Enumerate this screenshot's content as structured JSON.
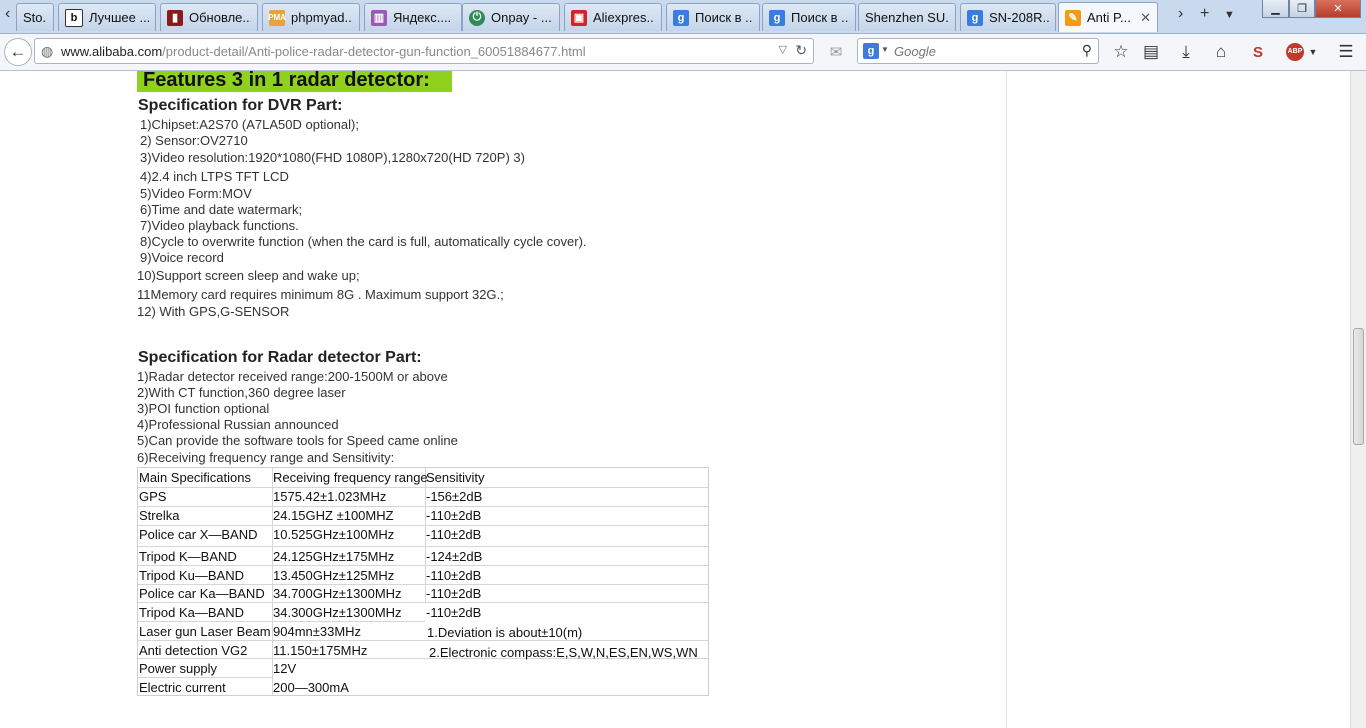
{
  "tabs": [
    {
      "title": "Sto...",
      "icon": "page-icon"
    },
    {
      "title": "Лучшее ...",
      "icon": "b-icon"
    },
    {
      "title": "Обновле...",
      "icon": "phone-icon"
    },
    {
      "title": "phpmyad...",
      "icon": "pma-icon"
    },
    {
      "title": "Яндекс....",
      "icon": "chart-icon"
    },
    {
      "title": "Onpay - ...",
      "icon": "power-icon"
    },
    {
      "title": "Aliexpres...",
      "icon": "bag-icon"
    },
    {
      "title": "Поиск в ...",
      "icon": "google-icon"
    },
    {
      "title": "Поиск в ...",
      "icon": "google-icon"
    },
    {
      "title": "Shenzhen SU...",
      "icon": ""
    },
    {
      "title": "SN-208R...",
      "icon": "google-icon"
    },
    {
      "title": "Anti P...",
      "icon": "alibaba-icon",
      "active": true
    }
  ],
  "nav": {
    "url_host": "www.alibaba.com",
    "url_path": "/product-detail/Anti-police-radar-detector-gun-function_60051884677.html",
    "search_placeholder": "Google"
  },
  "page": {
    "features_title": "Features 3 in 1 radar detector:",
    "dvr_heading": "Specification for DVR Part:",
    "dvr_lines": [
      "1)Chipset:A2S70 (A7LA50D optional);",
      "2) Sensor:OV2710",
      "3)Video resolution:1920*1080(FHD 1080P),1280x720(HD 720P) 3)",
      "4)2.4 inch LTPS TFT LCD",
      "5)Video Form:MOV",
      "6)Time and date watermark;",
      "7)Video playback functions.",
      "8)Cycle to overwrite function (when the card is full, automatically cycle cover).",
      "9)Voice record",
      "10)Support screen sleep and wake up;",
      "11Memory card requires minimum 8G . Maximum support 32G.;",
      "12) With GPS,G-SENSOR"
    ],
    "radar_heading": "Specification for Radar detector Part:",
    "radar_lines": [
      "1)Radar detector received range:200-1500M or above",
      "2)With CT function,360 degree laser",
      "3)POI function optional",
      "4)Professional Russian announced",
      "5)Can provide the software tools for Speed came online",
      "6)Receiving frequency range and Sensitivity:"
    ],
    "table": {
      "headers": [
        "Main Specifications",
        "Receiving frequency range",
        "Sensitivity"
      ],
      "rows": [
        [
          "GPS",
          "1575.42±1.023MHz",
          "-156±2dB"
        ],
        [
          "Strelka",
          "24.15GHZ ±100MHZ",
          "-110±2dB"
        ],
        [
          "Police car X—BAND",
          "10.525GHz±100MHz",
          "-110±2dB"
        ],
        [
          "Tripod K—BAND",
          "24.125GHz±175MHz",
          "-124±2dB"
        ],
        [
          "Tripod Ku—BAND",
          "13.450GHz±125MHz",
          "-110±2dB"
        ],
        [
          "Police car Ka—BAND",
          "34.700GHz±1300MHz",
          "-110±2dB"
        ],
        [
          "Tripod Ka—BAND",
          "34.300GHz±1300MHz",
          "-110±2dB"
        ],
        [
          "Laser gun Laser Beam",
          "904mn±33MHz",
          "1.Deviation is about±10(m)"
        ],
        [
          "Anti detection VG2",
          "11.150±175MHz",
          "2.Electronic compass:E,S,W,N,ES,EN,WS,WN"
        ],
        [
          "Power supply",
          "12V",
          ""
        ],
        [
          "Electric current",
          "200—300mA",
          ""
        ]
      ]
    }
  }
}
